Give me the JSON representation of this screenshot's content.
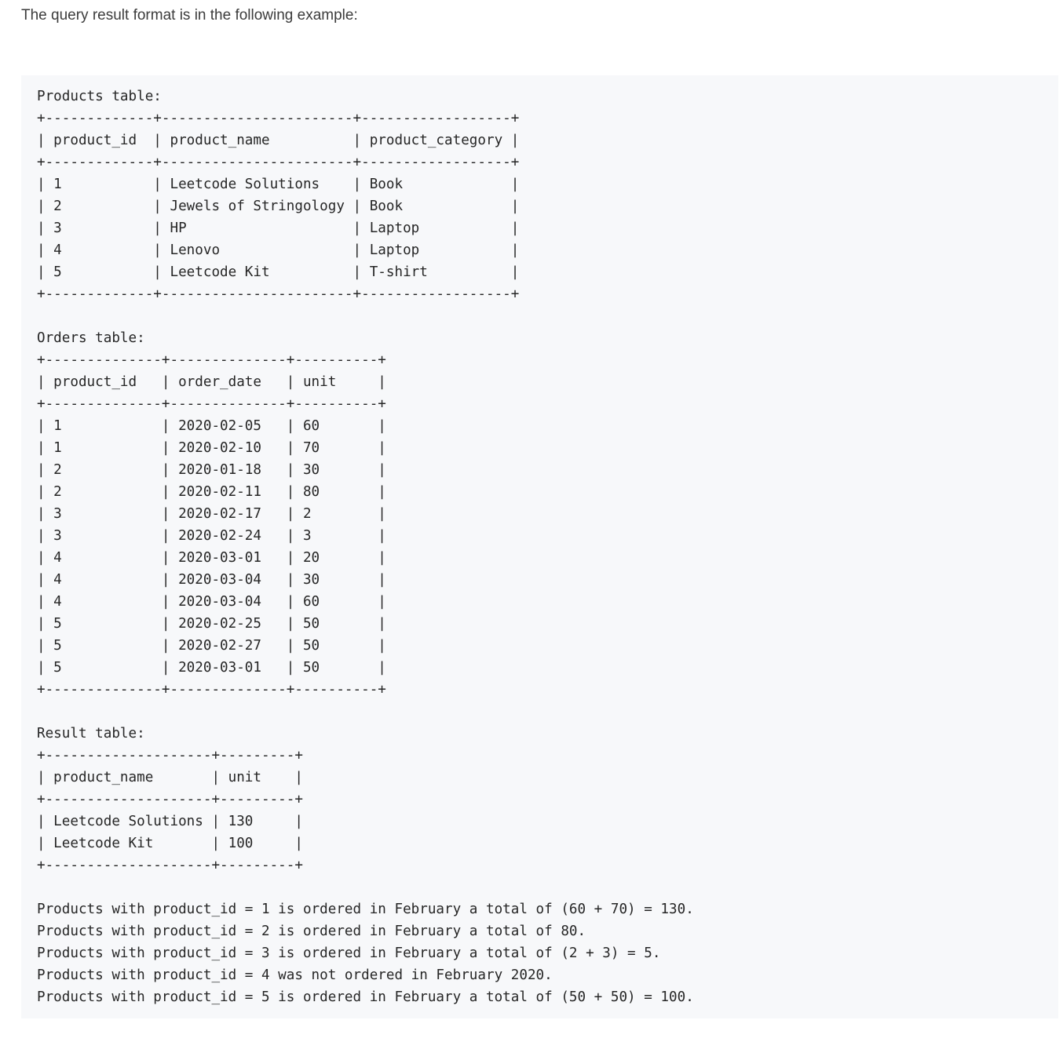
{
  "intro": "The query result format is in the following example:",
  "code_lines": [
    "Products table:",
    "+-------------+-----------------------+------------------+",
    "| product_id  | product_name          | product_category |",
    "+-------------+-----------------------+------------------+",
    "| 1           | Leetcode Solutions    | Book             |",
    "| 2           | Jewels of Stringology | Book             |",
    "| 3           | HP                    | Laptop           |",
    "| 4           | Lenovo                | Laptop           |",
    "| 5           | Leetcode Kit          | T-shirt          |",
    "+-------------+-----------------------+------------------+",
    "",
    "Orders table:",
    "+--------------+--------------+----------+",
    "| product_id   | order_date   | unit     |",
    "+--------------+--------------+----------+",
    "| 1            | 2020-02-05   | 60       |",
    "| 1            | 2020-02-10   | 70       |",
    "| 2            | 2020-01-18   | 30       |",
    "| 2            | 2020-02-11   | 80       |",
    "| 3            | 2020-02-17   | 2        |",
    "| 3            | 2020-02-24   | 3        |",
    "| 4            | 2020-03-01   | 20       |",
    "| 4            | 2020-03-04   | 30       |",
    "| 4            | 2020-03-04   | 60       |",
    "| 5            | 2020-02-25   | 50       |",
    "| 5            | 2020-02-27   | 50       |",
    "| 5            | 2020-03-01   | 50       |",
    "+--------------+--------------+----------+",
    "",
    "Result table:",
    "+--------------------+---------+",
    "| product_name       | unit    |",
    "+--------------------+---------+",
    "| Leetcode Solutions | 130     |",
    "| Leetcode Kit       | 100     |",
    "+--------------------+---------+",
    "",
    "Products with product_id = 1 is ordered in February a total of (60 + 70) = 130.",
    "Products with product_id = 2 is ordered in February a total of 80.",
    "Products with product_id = 3 is ordered in February a total of (2 + 3) = 5.",
    "Products with product_id = 4 was not ordered in February 2020.",
    "Products with product_id = 5 is ordered in February a total of (50 + 50) = 100."
  ]
}
